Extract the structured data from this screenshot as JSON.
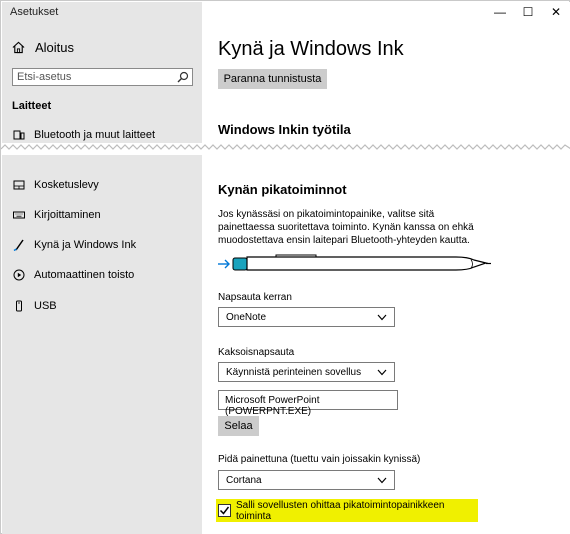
{
  "window": {
    "title": "Asetukset",
    "minimize": "—",
    "maximize": "☐",
    "close": "✕"
  },
  "sidebar": {
    "home_label": "Aloitus",
    "search_placeholder": "Etsi-asetus",
    "section": "Laitteet",
    "items": [
      {
        "label": "Bluetooth ja muut laitteet",
        "icon": "bluetooth-devices-icon"
      },
      {
        "label": "Kosketuslevy",
        "icon": "touchpad-icon"
      },
      {
        "label": "Kirjoittaminen",
        "icon": "keyboard-icon"
      },
      {
        "label": "Kynä ja Windows Ink",
        "icon": "pen-icon"
      },
      {
        "label": "Automaattinen toisto",
        "icon": "autoplay-icon"
      },
      {
        "label": "USB",
        "icon": "usb-icon"
      }
    ]
  },
  "main": {
    "page_title": "Kynä ja Windows Ink",
    "improve_button": "Paranna tunnistusta",
    "ink_workspace_title": "Windows Inkin työtila",
    "shortcuts_title": "Kynän pikatoiminnot",
    "description": "Jos kynässäsi on pikatoimintopainike, valitse sitä painettaessa suoritettava toiminto. Kynän kanssa on ehkä muodostettava ensin laitepari Bluetooth-yhteyden kautta.",
    "single_click_label": "Napsauta kerran",
    "single_click_value": "OneNote",
    "double_click_label": "Kaksoisnapsauta",
    "double_click_value": "Käynnistä perinteinen sovellus",
    "app_path_value": "Microsoft PowerPoint (POWERPNT.EXE)",
    "browse_button": "Selaa",
    "press_hold_label": "Pidä painettuna (tuettu vain joissakin kynissä)",
    "press_hold_value": "Cortana",
    "override_checkbox_label": "Salli sovellusten ohittaa pikatoimintopainikkeen toiminta",
    "override_checked": true
  },
  "colors": {
    "sidebar_bg": "#e6e6e6",
    "accent": "#0078d7",
    "highlight": "#f0f000",
    "button_bg": "#cccccc"
  }
}
